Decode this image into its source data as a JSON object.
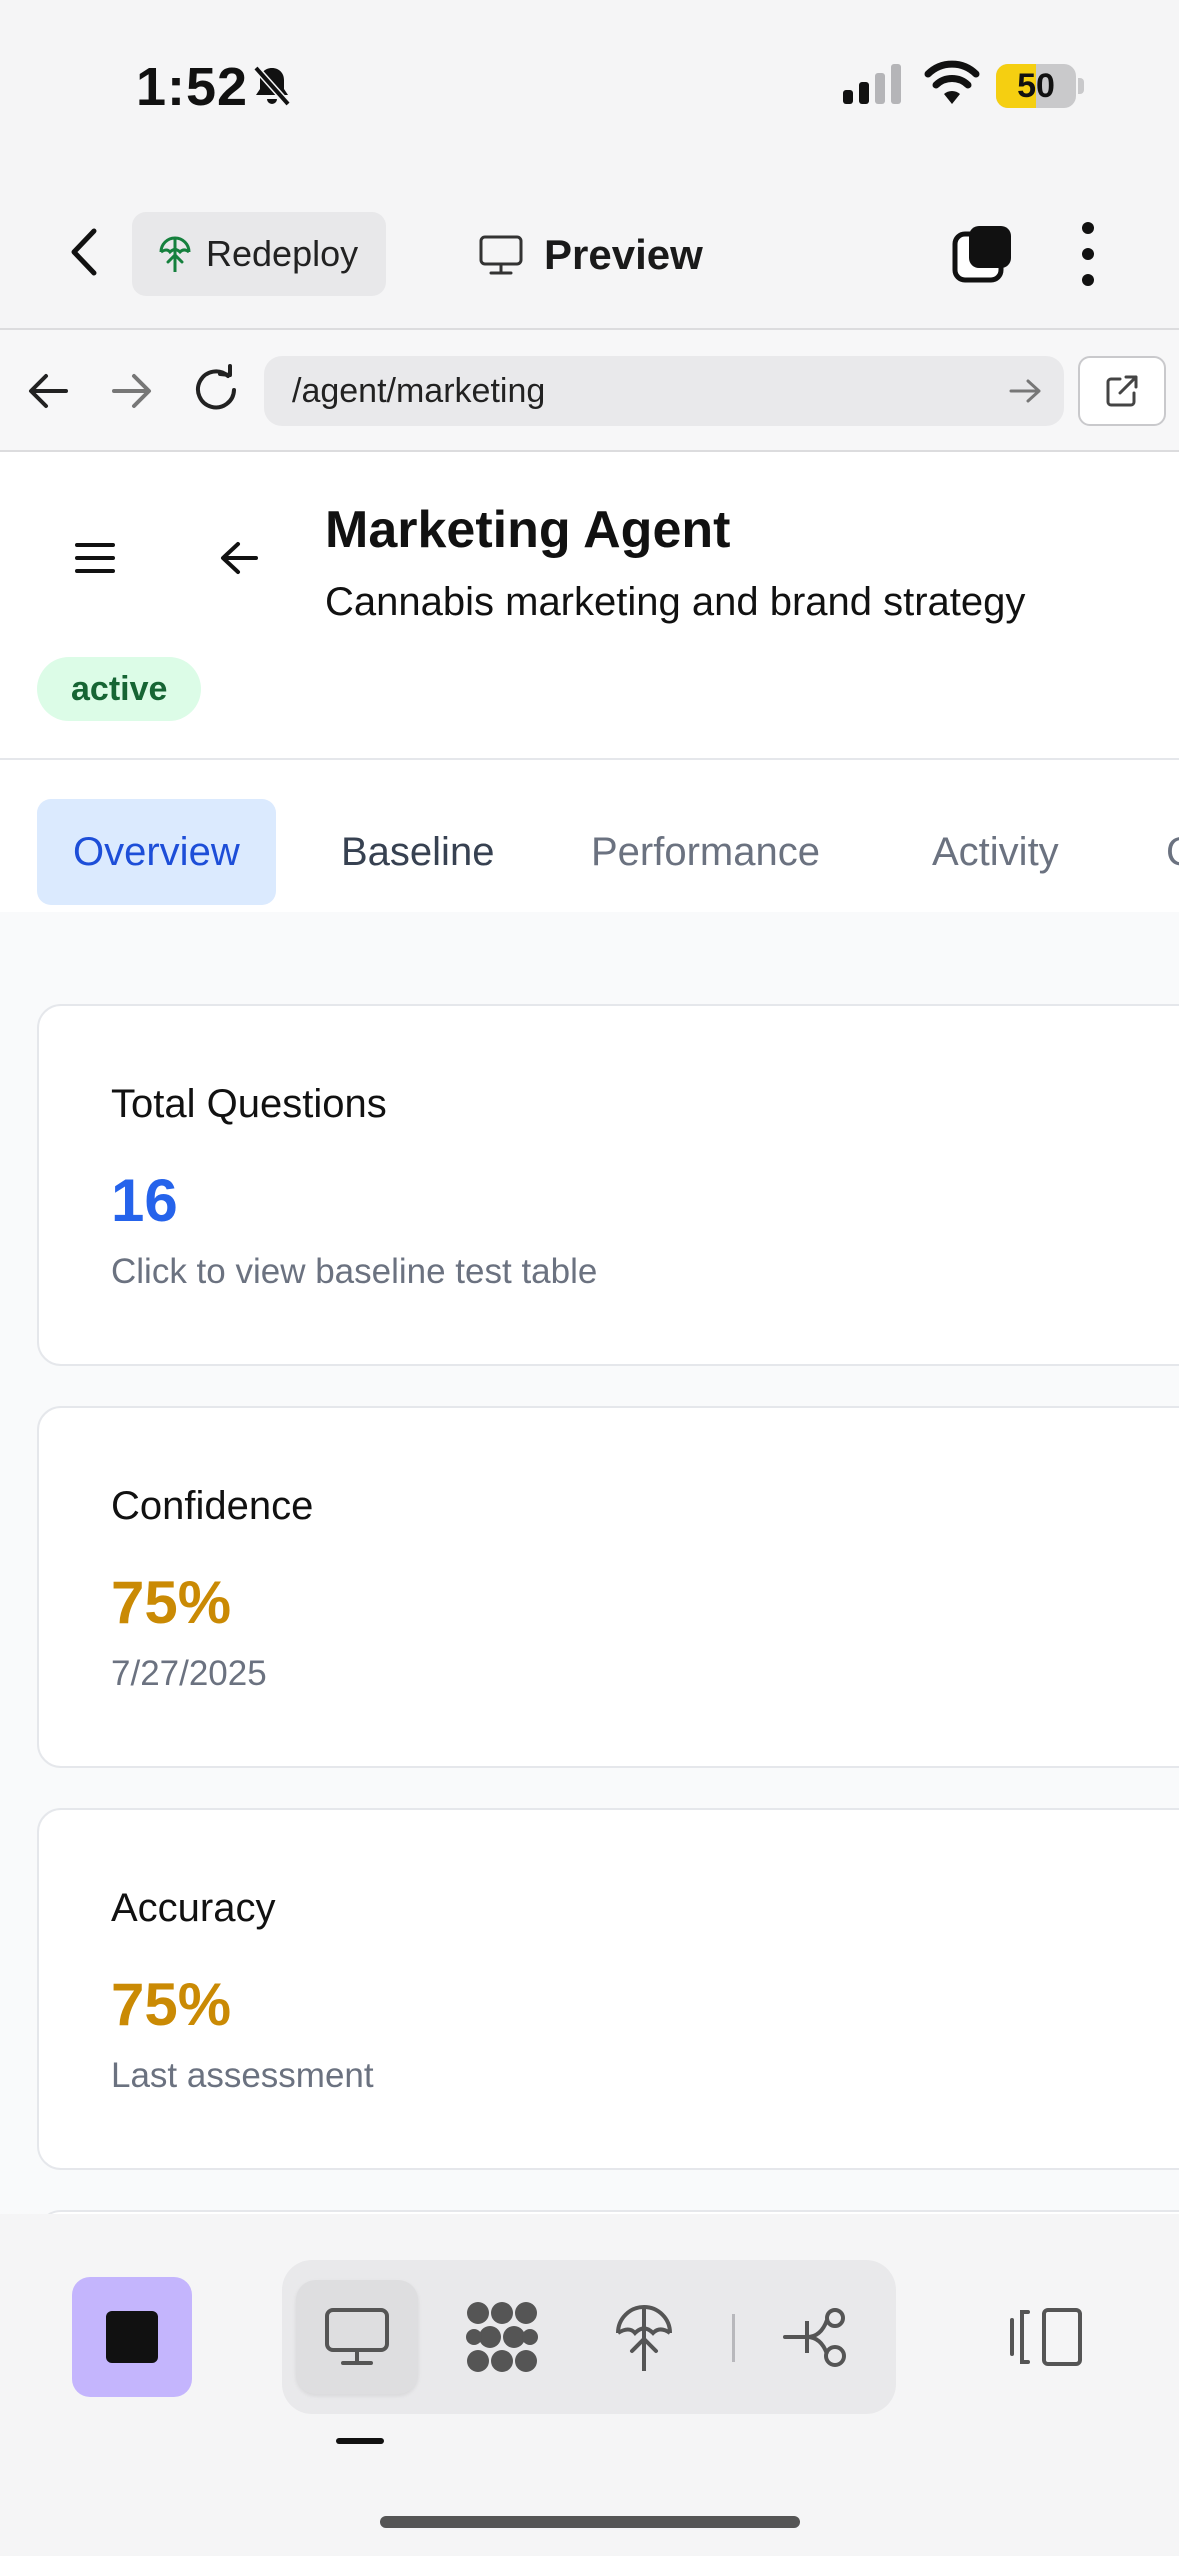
{
  "status_bar": {
    "time": "1:52",
    "battery_level": "50",
    "battery_fill_fraction": 0.5
  },
  "app_toolbar": {
    "redeploy_label": "Redeploy",
    "preview_label": "Preview"
  },
  "url_bar": {
    "url": "/agent/marketing"
  },
  "page_header": {
    "title": "Marketing Agent",
    "subtitle": "Cannabis marketing and brand strategy",
    "status": "active"
  },
  "tabs": [
    {
      "label": "Overview",
      "active": true
    },
    {
      "label": "Baseline",
      "active": false
    },
    {
      "label": "Performance",
      "active": false
    },
    {
      "label": "Activity",
      "active": false
    },
    {
      "label": "C",
      "active": false
    }
  ],
  "cards": [
    {
      "title": "Total Questions",
      "value": "16",
      "value_color": "#2563eb",
      "subtitle": "Click to view baseline test table"
    },
    {
      "title": "Confidence",
      "value": "75%",
      "value_color": "#ca8a04",
      "subtitle": "7/27/2025"
    },
    {
      "title": "Accuracy",
      "value": "75%",
      "value_color": "#ca8a04",
      "subtitle": "Last assessment"
    }
  ],
  "dock": {
    "icons": [
      "stop-icon",
      "monitor-icon",
      "bubbles-icon",
      "deploy-icon",
      "flow-icon",
      "panel-icon"
    ]
  },
  "colors": {
    "accent_blue": "#1d4ed8",
    "active_badge_bg": "#dcfce7",
    "active_badge_text": "#166534",
    "stop_button": "#c4b5fd"
  }
}
